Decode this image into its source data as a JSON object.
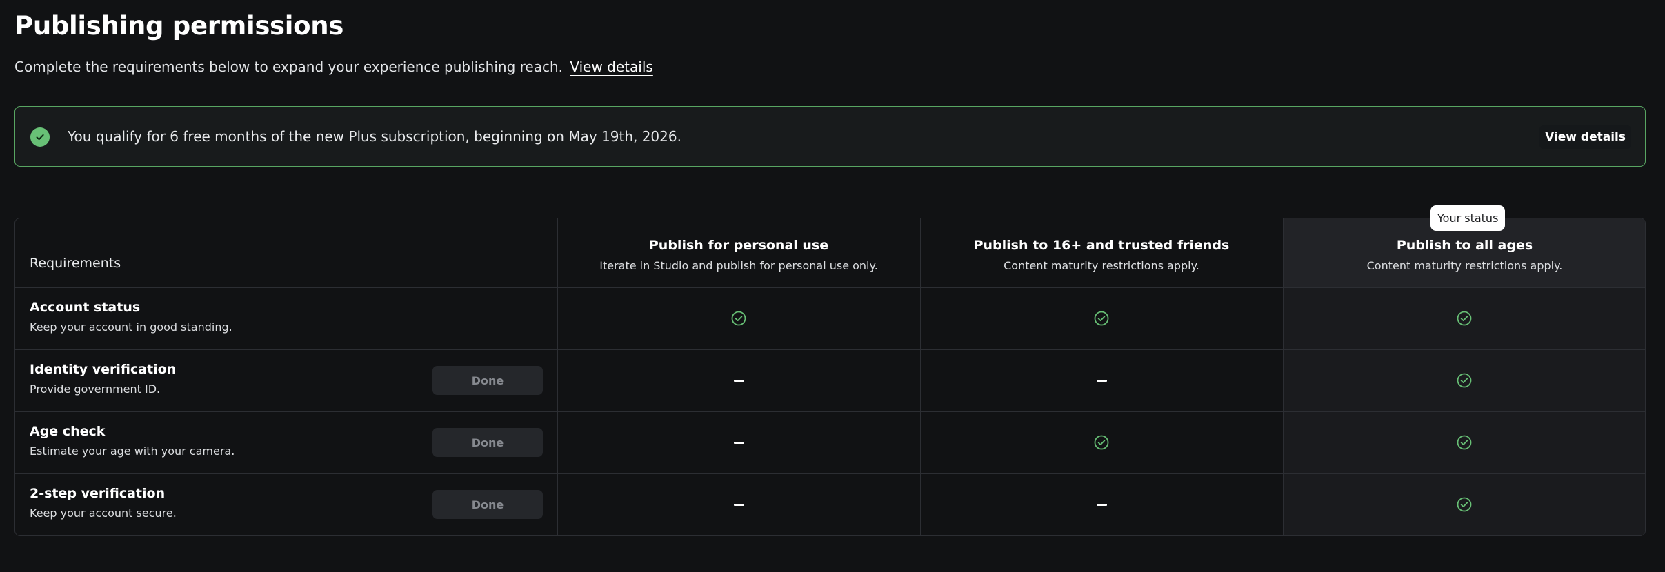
{
  "header": {
    "title": "Publishing permissions",
    "subtitle": "Complete the requirements below to expand your experience publishing reach.",
    "subtitle_link": "View details"
  },
  "banner": {
    "message": "You qualify for 6 free months of the new Plus subscription, beginning on May 19th, 2026.",
    "button": "View details",
    "accent": "#68c076"
  },
  "table": {
    "requirements_header": "Requirements",
    "tooltip": "Your status",
    "columns": [
      {
        "heading": "Publish for personal use",
        "description": "Iterate in Studio and publish for personal use only."
      },
      {
        "heading": "Publish to 16+ and trusted friends",
        "description": "Content maturity restrictions apply."
      },
      {
        "heading": "Publish to all ages",
        "description": "Content maturity restrictions apply."
      }
    ],
    "rows": [
      {
        "title": "Account status",
        "description": "Keep your account in good standing.",
        "button": "",
        "cells": [
          "check",
          "check",
          "check"
        ]
      },
      {
        "title": "Identity verification",
        "description": "Provide government ID.",
        "button": "Done",
        "cells": [
          "dash",
          "dash",
          "check"
        ]
      },
      {
        "title": "Age check",
        "description": "Estimate your age with your camera.",
        "button": "Done",
        "cells": [
          "dash",
          "check",
          "check"
        ]
      },
      {
        "title": "2-step verification",
        "description": "Keep your account secure.",
        "button": "Done",
        "cells": [
          "dash",
          "dash",
          "check"
        ]
      }
    ],
    "check_color": "#68c076"
  }
}
